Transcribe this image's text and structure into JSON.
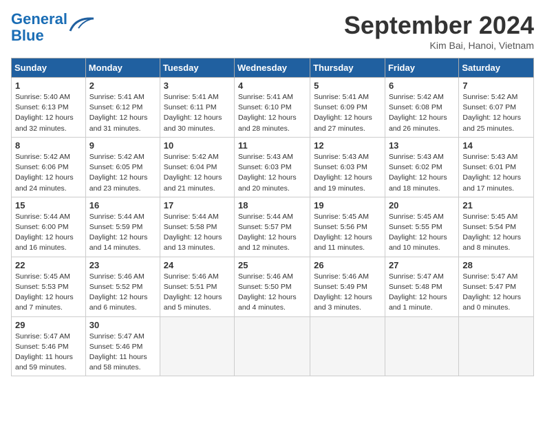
{
  "header": {
    "logo_line1": "General",
    "logo_line2": "Blue",
    "month_title": "September 2024",
    "location": "Kim Bai, Hanoi, Vietnam"
  },
  "weekdays": [
    "Sunday",
    "Monday",
    "Tuesday",
    "Wednesday",
    "Thursday",
    "Friday",
    "Saturday"
  ],
  "weeks": [
    [
      {
        "day": "1",
        "detail": "Sunrise: 5:40 AM\nSunset: 6:13 PM\nDaylight: 12 hours\nand 32 minutes."
      },
      {
        "day": "2",
        "detail": "Sunrise: 5:41 AM\nSunset: 6:12 PM\nDaylight: 12 hours\nand 31 minutes."
      },
      {
        "day": "3",
        "detail": "Sunrise: 5:41 AM\nSunset: 6:11 PM\nDaylight: 12 hours\nand 30 minutes."
      },
      {
        "day": "4",
        "detail": "Sunrise: 5:41 AM\nSunset: 6:10 PM\nDaylight: 12 hours\nand 28 minutes."
      },
      {
        "day": "5",
        "detail": "Sunrise: 5:41 AM\nSunset: 6:09 PM\nDaylight: 12 hours\nand 27 minutes."
      },
      {
        "day": "6",
        "detail": "Sunrise: 5:42 AM\nSunset: 6:08 PM\nDaylight: 12 hours\nand 26 minutes."
      },
      {
        "day": "7",
        "detail": "Sunrise: 5:42 AM\nSunset: 6:07 PM\nDaylight: 12 hours\nand 25 minutes."
      }
    ],
    [
      {
        "day": "8",
        "detail": "Sunrise: 5:42 AM\nSunset: 6:06 PM\nDaylight: 12 hours\nand 24 minutes."
      },
      {
        "day": "9",
        "detail": "Sunrise: 5:42 AM\nSunset: 6:05 PM\nDaylight: 12 hours\nand 23 minutes."
      },
      {
        "day": "10",
        "detail": "Sunrise: 5:42 AM\nSunset: 6:04 PM\nDaylight: 12 hours\nand 21 minutes."
      },
      {
        "day": "11",
        "detail": "Sunrise: 5:43 AM\nSunset: 6:03 PM\nDaylight: 12 hours\nand 20 minutes."
      },
      {
        "day": "12",
        "detail": "Sunrise: 5:43 AM\nSunset: 6:03 PM\nDaylight: 12 hours\nand 19 minutes."
      },
      {
        "day": "13",
        "detail": "Sunrise: 5:43 AM\nSunset: 6:02 PM\nDaylight: 12 hours\nand 18 minutes."
      },
      {
        "day": "14",
        "detail": "Sunrise: 5:43 AM\nSunset: 6:01 PM\nDaylight: 12 hours\nand 17 minutes."
      }
    ],
    [
      {
        "day": "15",
        "detail": "Sunrise: 5:44 AM\nSunset: 6:00 PM\nDaylight: 12 hours\nand 16 minutes."
      },
      {
        "day": "16",
        "detail": "Sunrise: 5:44 AM\nSunset: 5:59 PM\nDaylight: 12 hours\nand 14 minutes."
      },
      {
        "day": "17",
        "detail": "Sunrise: 5:44 AM\nSunset: 5:58 PM\nDaylight: 12 hours\nand 13 minutes."
      },
      {
        "day": "18",
        "detail": "Sunrise: 5:44 AM\nSunset: 5:57 PM\nDaylight: 12 hours\nand 12 minutes."
      },
      {
        "day": "19",
        "detail": "Sunrise: 5:45 AM\nSunset: 5:56 PM\nDaylight: 12 hours\nand 11 minutes."
      },
      {
        "day": "20",
        "detail": "Sunrise: 5:45 AM\nSunset: 5:55 PM\nDaylight: 12 hours\nand 10 minutes."
      },
      {
        "day": "21",
        "detail": "Sunrise: 5:45 AM\nSunset: 5:54 PM\nDaylight: 12 hours\nand 8 minutes."
      }
    ],
    [
      {
        "day": "22",
        "detail": "Sunrise: 5:45 AM\nSunset: 5:53 PM\nDaylight: 12 hours\nand 7 minutes."
      },
      {
        "day": "23",
        "detail": "Sunrise: 5:46 AM\nSunset: 5:52 PM\nDaylight: 12 hours\nand 6 minutes."
      },
      {
        "day": "24",
        "detail": "Sunrise: 5:46 AM\nSunset: 5:51 PM\nDaylight: 12 hours\nand 5 minutes."
      },
      {
        "day": "25",
        "detail": "Sunrise: 5:46 AM\nSunset: 5:50 PM\nDaylight: 12 hours\nand 4 minutes."
      },
      {
        "day": "26",
        "detail": "Sunrise: 5:46 AM\nSunset: 5:49 PM\nDaylight: 12 hours\nand 3 minutes."
      },
      {
        "day": "27",
        "detail": "Sunrise: 5:47 AM\nSunset: 5:48 PM\nDaylight: 12 hours\nand 1 minute."
      },
      {
        "day": "28",
        "detail": "Sunrise: 5:47 AM\nSunset: 5:47 PM\nDaylight: 12 hours\nand 0 minutes."
      }
    ],
    [
      {
        "day": "29",
        "detail": "Sunrise: 5:47 AM\nSunset: 5:46 PM\nDaylight: 11 hours\nand 59 minutes."
      },
      {
        "day": "30",
        "detail": "Sunrise: 5:47 AM\nSunset: 5:46 PM\nDaylight: 11 hours\nand 58 minutes."
      },
      {
        "day": "",
        "detail": ""
      },
      {
        "day": "",
        "detail": ""
      },
      {
        "day": "",
        "detail": ""
      },
      {
        "day": "",
        "detail": ""
      },
      {
        "day": "",
        "detail": ""
      }
    ]
  ]
}
